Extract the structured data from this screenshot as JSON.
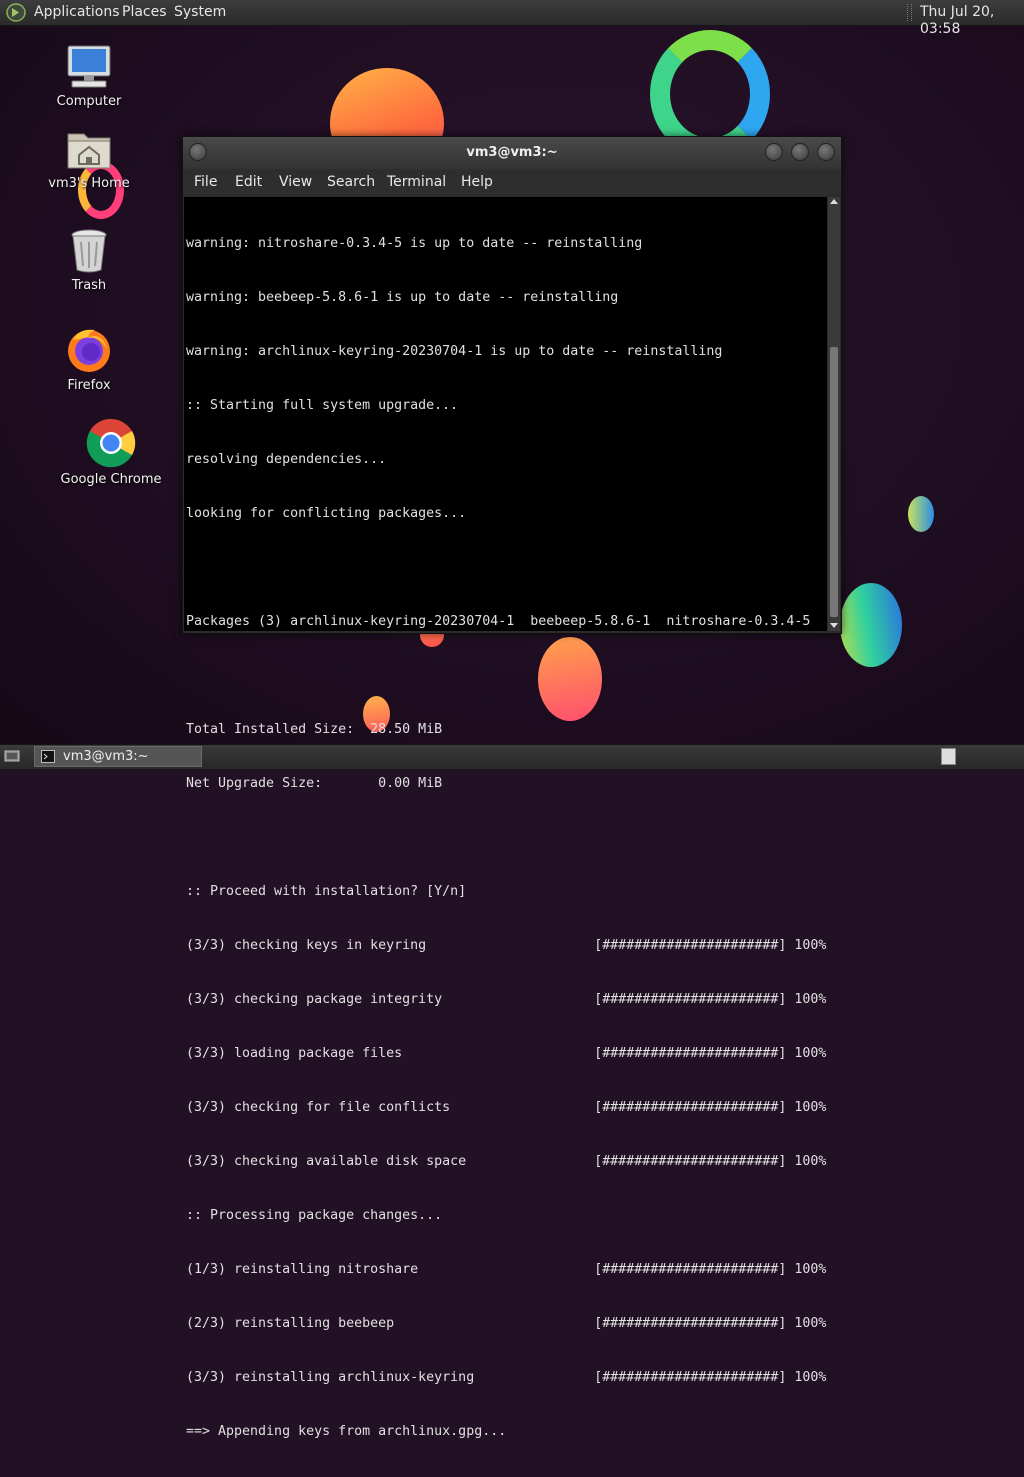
{
  "top_panel": {
    "menus": [
      "Applications",
      "Places",
      "System"
    ],
    "clock": "Thu Jul 20, 03:58"
  },
  "desktop_icons": [
    {
      "label": "Computer",
      "icon": "computer-icon"
    },
    {
      "label": "vm3's Home",
      "icon": "home-folder-icon"
    },
    {
      "label": "Trash",
      "icon": "trash-icon"
    },
    {
      "label": "Firefox",
      "icon": "firefox-icon"
    },
    {
      "label": "Google Chrome",
      "icon": "chrome-icon"
    }
  ],
  "terminal": {
    "title": "vm3@vm3:~",
    "menus": [
      "File",
      "Edit",
      "View",
      "Search",
      "Terminal",
      "Help"
    ],
    "lines": [
      "warning: nitroshare-0.3.4-5 is up to date -- reinstalling",
      "warning: beebeep-5.8.6-1 is up to date -- reinstalling",
      "warning: archlinux-keyring-20230704-1 is up to date -- reinstalling",
      ":: Starting full system upgrade...",
      "resolving dependencies...",
      "looking for conflicting packages...",
      "",
      "Packages (3) archlinux-keyring-20230704-1  beebeep-5.8.6-1  nitroshare-0.3.4-5",
      "",
      "Total Installed Size:  28.50 MiB",
      "Net Upgrade Size:       0.00 MiB",
      "",
      ":: Proceed with installation? [Y/n]",
      "(3/3) checking keys in keyring                     [######################] 100%",
      "(3/3) checking package integrity                   [######################] 100%",
      "(3/3) loading package files                        [######################] 100%",
      "(3/3) checking for file conflicts                  [######################] 100%",
      "(3/3) checking available disk space                [######################] 100%",
      ":: Processing package changes...",
      "(1/3) reinstalling nitroshare                      [######################] 100%",
      "(2/3) reinstalling beebeep                         [######################] 100%",
      "(3/3) reinstalling archlinux-keyring               [######################] 100%",
      "==> Appending keys from archlinux.gpg..."
    ]
  },
  "taskbar": {
    "task_label": "vm3@vm3:~"
  },
  "colors": {
    "desktop_bg": "#221024",
    "terminal_bg": "#000000",
    "terminal_fg": "#e0e0e0"
  }
}
